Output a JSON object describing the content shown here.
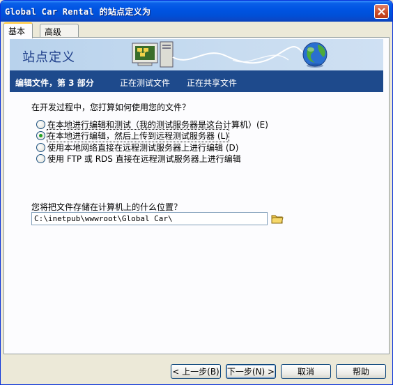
{
  "window": {
    "title": "Global Car Rental 的站点定义为"
  },
  "tabs": [
    {
      "label": "基本",
      "active": true
    },
    {
      "label": "高级",
      "active": false
    }
  ],
  "banner": {
    "title": "站点定义"
  },
  "steps": [
    {
      "label": "编辑文件，第 3 部分",
      "current": true
    },
    {
      "label": "正在测试文件",
      "current": false
    },
    {
      "label": "正在共享文件",
      "current": false
    }
  ],
  "form": {
    "question": "在开发过程中，您打算如何使用您的文件？",
    "options": [
      {
        "label": "在本地进行编辑和测试（我的测试服务器是这台计算机）(E)",
        "checked": false
      },
      {
        "label": "在本地进行编辑，然后上传到远程测试服务器 (L)",
        "checked": true
      },
      {
        "label": "使用本地网络直接在远程测试服务器上进行编辑 (D)",
        "checked": false
      },
      {
        "label": "使用 FTP 或 RDS 直接在远程测试服务器上进行编辑",
        "checked": false
      }
    ],
    "path_question": "您将把文件存储在计算机上的什么位置？",
    "path_value": "C:\\inetpub\\wwwroot\\Global Car\\"
  },
  "buttons": {
    "back": "< 上一步(B)",
    "next": "下一步(N) >",
    "cancel": "取消",
    "help": "帮助"
  },
  "colors": {
    "titlebar": "#0054e3",
    "stepbar": "#1e4a8c",
    "banner": "#c8dcf0",
    "radio_dot": "#21a121"
  },
  "icons": [
    "close-icon",
    "computer-network-icon",
    "globe-icon",
    "folder-icon"
  ]
}
